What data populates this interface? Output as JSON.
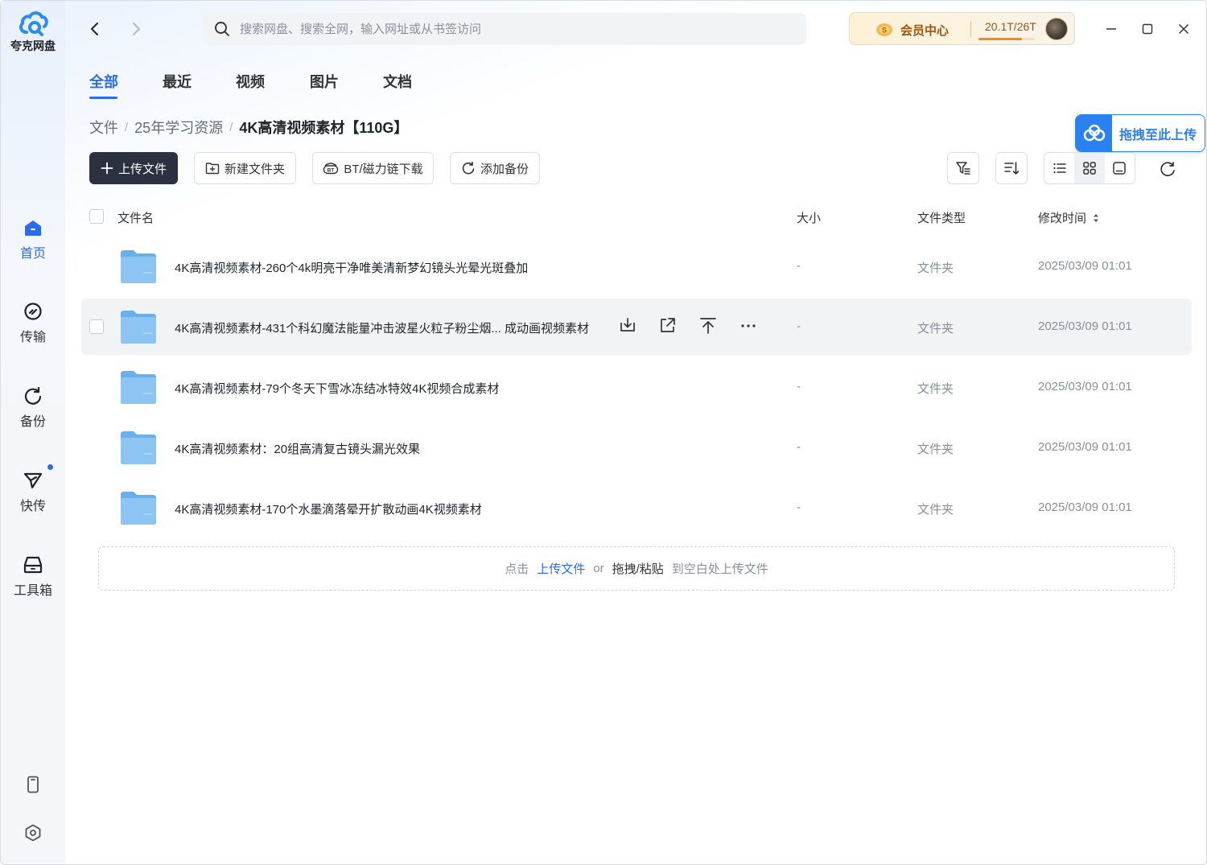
{
  "app": {
    "name": "夸克网盘"
  },
  "sidebar": {
    "items": [
      {
        "label": "首页",
        "icon": "home-icon",
        "active": true
      },
      {
        "label": "传输",
        "icon": "transfer-icon",
        "active": false
      },
      {
        "label": "备份",
        "icon": "backup-icon",
        "active": false
      },
      {
        "label": "快传",
        "icon": "send-icon",
        "active": false,
        "badge_dot": true
      },
      {
        "label": "工具箱",
        "icon": "toolbox-icon",
        "active": false
      }
    ],
    "bottom": [
      "phone-icon",
      "settings-icon"
    ]
  },
  "search": {
    "placeholder": "搜索网盘、搜索全网，输入网址或从书签访问"
  },
  "vip": {
    "label": "会员中心",
    "quota": "20.1T/26T",
    "quota_used_fraction": 0.77
  },
  "tabs": [
    "全部",
    "最近",
    "视频",
    "图片",
    "文档"
  ],
  "active_tab": "全部",
  "breadcrumb": [
    "文件",
    "25年学习资源",
    "4K高清视频素材【110G】"
  ],
  "upload_float_label": "拖拽至此上传",
  "toolbar": {
    "upload": "上传文件",
    "new_folder": "新建文件夹",
    "bt_download": "BT/磁力链下载",
    "add_backup": "添加备份"
  },
  "table": {
    "headers": {
      "name": "文件名",
      "size": "大小",
      "type": "文件类型",
      "modified": "修改时间"
    },
    "rows": [
      {
        "name": "4K高清视频素材-260个4k明亮干净唯美清新梦幻镜头光晕光斑叠加",
        "size": "-",
        "type": "文件夹",
        "modified": "2025/03/09 01:01"
      },
      {
        "name": "4K高清视频素材-431个科幻魔法能量冲击波星火粒子粉尘烟... 成动画视频素材",
        "size": "-",
        "type": "文件夹",
        "modified": "2025/03/09 01:01"
      },
      {
        "name": "4K高清视频素材-79个冬天下雪冰冻结冰特效4K视频合成素材",
        "size": "-",
        "type": "文件夹",
        "modified": "2025/03/09 01:01"
      },
      {
        "name": "4K高清视频素材：20组高清复古镜头漏光效果",
        "size": "-",
        "type": "文件夹",
        "modified": "2025/03/09 01:01"
      },
      {
        "name": "4K高清视频素材-170个水墨滴落晕开扩散动画4K视频素材",
        "size": "-",
        "type": "文件夹",
        "modified": "2025/03/09 01:01"
      }
    ],
    "hovered_row": 1
  },
  "dropzone": {
    "prefix": "点击",
    "upload_link": "上传文件",
    "or": "or",
    "drag": "拖拽/粘贴",
    "suffix": "到空白处上传文件"
  },
  "colors": {
    "accent": "#2a6bf2",
    "primary_button": "#2b3140",
    "vip_text": "#a0540e",
    "folder": "#7db8ef"
  }
}
